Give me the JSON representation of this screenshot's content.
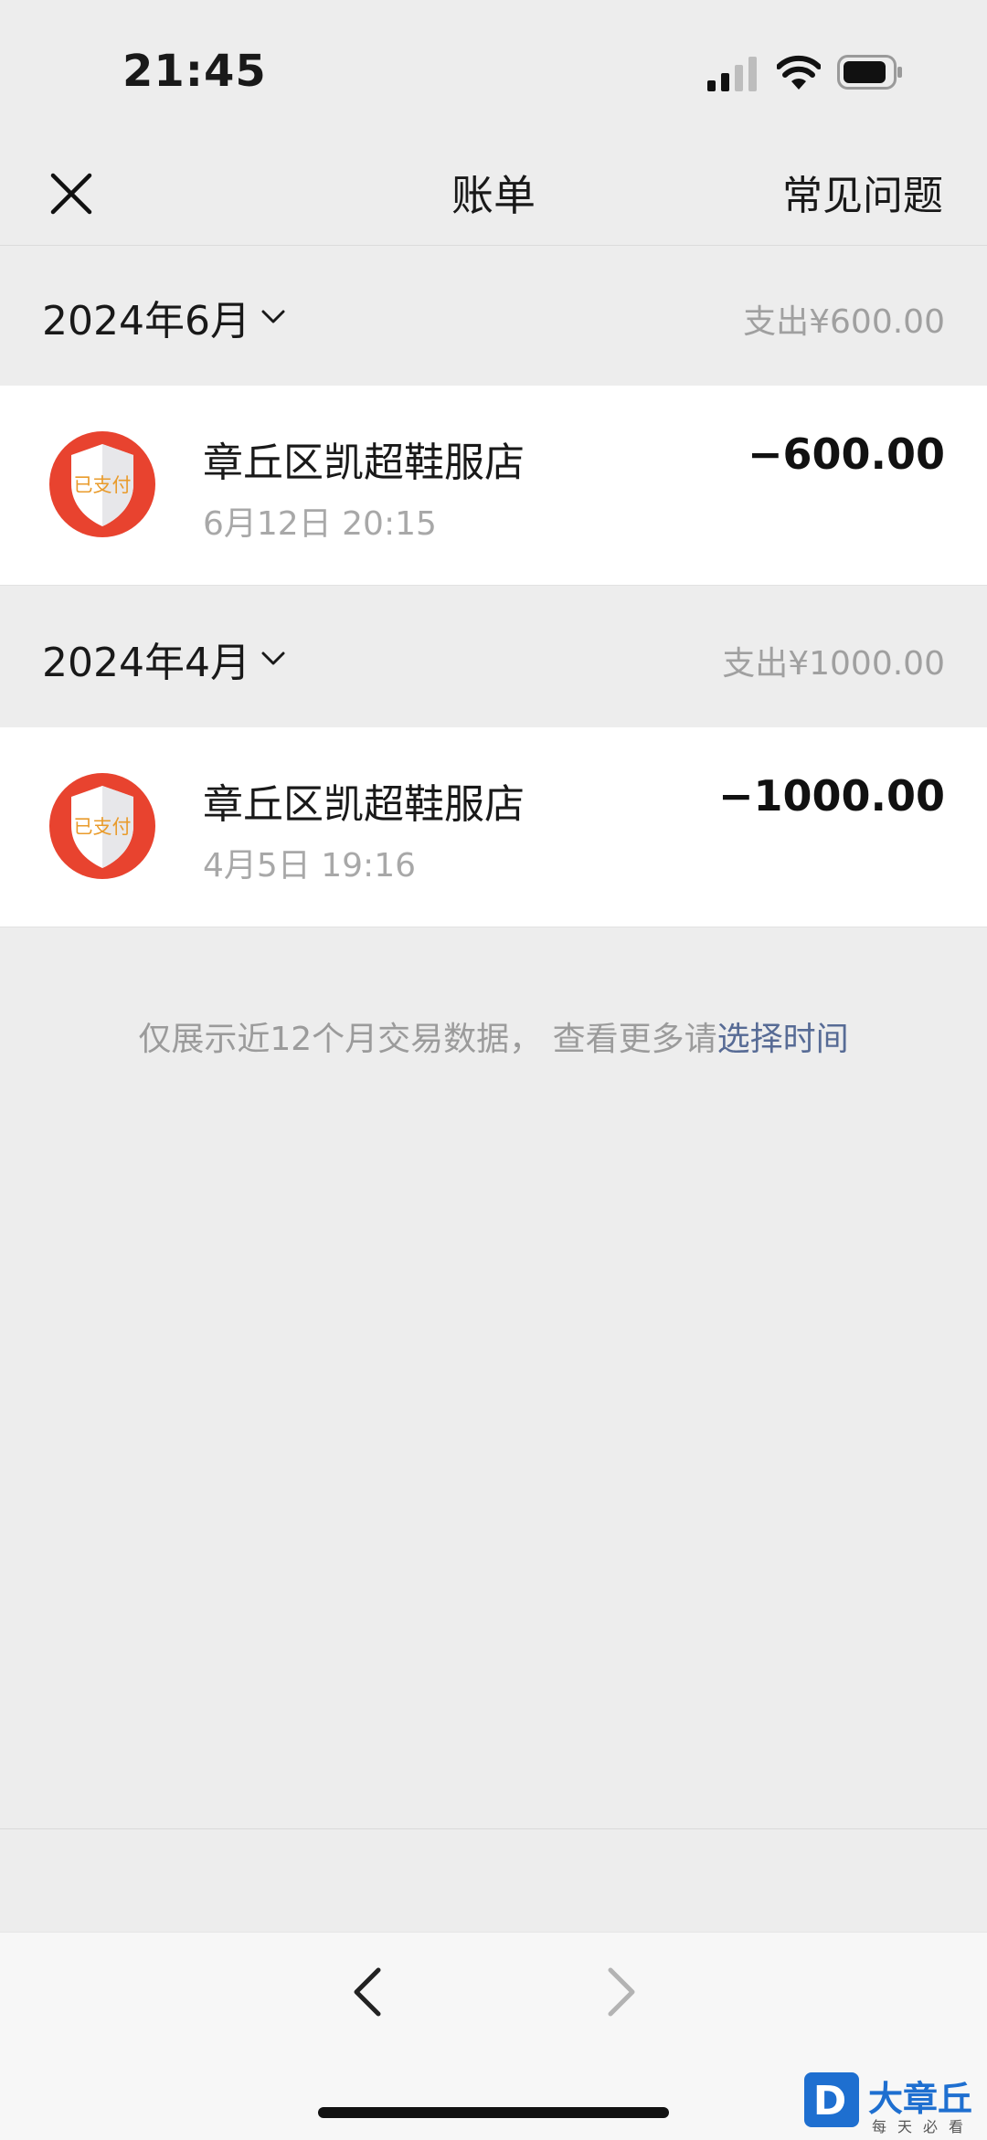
{
  "status_bar": {
    "time": "21:45"
  },
  "nav": {
    "title": "账单",
    "faq_label": "常见问题"
  },
  "months": [
    {
      "label": "2024年6月",
      "total": "支出¥600.00",
      "bills": [
        {
          "merchant": "章丘区凯超鞋服店",
          "time": "6月12日 20:15",
          "amount": "−600.00",
          "badge": "已支付"
        }
      ]
    },
    {
      "label": "2024年4月",
      "total": "支出¥1000.00",
      "bills": [
        {
          "merchant": "章丘区凯超鞋服店",
          "time": "4月5日 19:16",
          "amount": "−1000.00",
          "badge": "已支付"
        }
      ]
    }
  ],
  "footer": {
    "note_text": "仅展示近12个月交易数据， 查看更多请",
    "note_link": "选择时间"
  },
  "watermark": {
    "name": "大章丘",
    "tagline": "每天必看",
    "logo_letter": "D"
  },
  "colors": {
    "link": "#576b95",
    "badge_red": "#e8432f",
    "watermark_blue": "#1e6fd0"
  }
}
